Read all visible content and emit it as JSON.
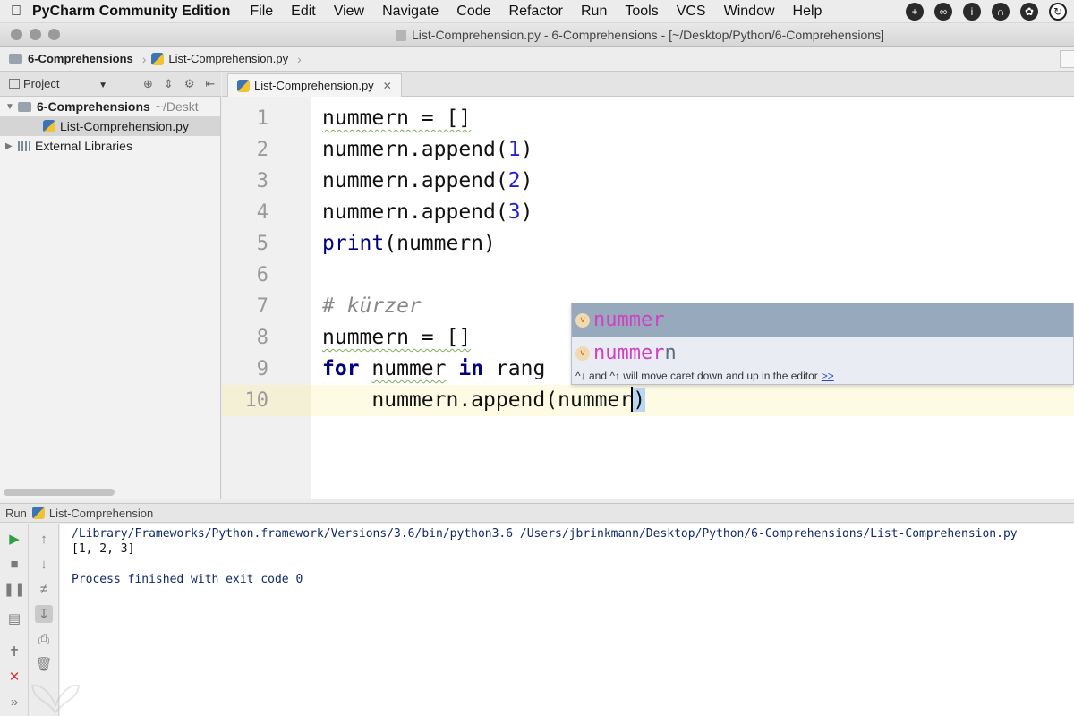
{
  "menubar": {
    "apple_icon": "apple-logo-icon",
    "app_name": "PyCharm Community Edition",
    "menus": [
      "File",
      "Edit",
      "View",
      "Navigate",
      "Code",
      "Refactor",
      "Run",
      "Tools",
      "VCS",
      "Window",
      "Help"
    ],
    "tray_icons": [
      "plus-icon",
      "creative-cloud-icon",
      "info-icon",
      "podcast-icon",
      "evernote-icon",
      "time-machine-icon"
    ]
  },
  "window": {
    "title": "List-Comprehension.py - 6-Comprehensions - [~/Desktop/Python/6-Comprehensions]"
  },
  "breadcrumb": {
    "project": "6-Comprehensions",
    "file": "List-Comprehension.py"
  },
  "project_panel": {
    "header_label": "Project",
    "root_name": "6-Comprehensions",
    "root_path": "~/Deskt",
    "file_name": "List-Comprehension.py",
    "libraries_label": "External Libraries"
  },
  "editor": {
    "tab_label": "List-Comprehension.py",
    "line_numbers": [
      "1",
      "2",
      "3",
      "4",
      "5",
      "6",
      "7",
      "8",
      "9",
      "10"
    ],
    "lines": {
      "l1": "nummern = []",
      "l2_a": "nummern.append(",
      "l2_n": "1",
      "l2_b": ")",
      "l3_a": "nummern.append(",
      "l3_n": "2",
      "l3_b": ")",
      "l4_a": "nummern.append(",
      "l4_n": "3",
      "l4_b": ")",
      "l5_fn": "print",
      "l5_rest": "(nummern)",
      "l7": "# kürzer",
      "l8": "nummern = []",
      "l9_kw1": "for",
      "l9_var": "nummer",
      "l9_kw2": "in",
      "l9_rest": "rang",
      "l10_a": "    nummern.append(nummer",
      "l10_b": ")"
    }
  },
  "completion": {
    "items": [
      {
        "match": "nummer",
        "rest": "",
        "badge": "v"
      },
      {
        "match": "nummer",
        "rest": "n",
        "badge": "v"
      }
    ],
    "hint": "^↓ and ^↑ will move caret down and up in the editor",
    "hint_link": ">>"
  },
  "run_panel": {
    "label": "Run",
    "config": "List-Comprehension",
    "command": "/Library/Frameworks/Python.framework/Versions/3.6/bin/python3.6 /Users/jbrinkmann/Desktop/Python/6-Comprehensions/List-Comprehension.py",
    "output": "[1, 2, 3]",
    "status": "Process finished with exit code 0"
  }
}
